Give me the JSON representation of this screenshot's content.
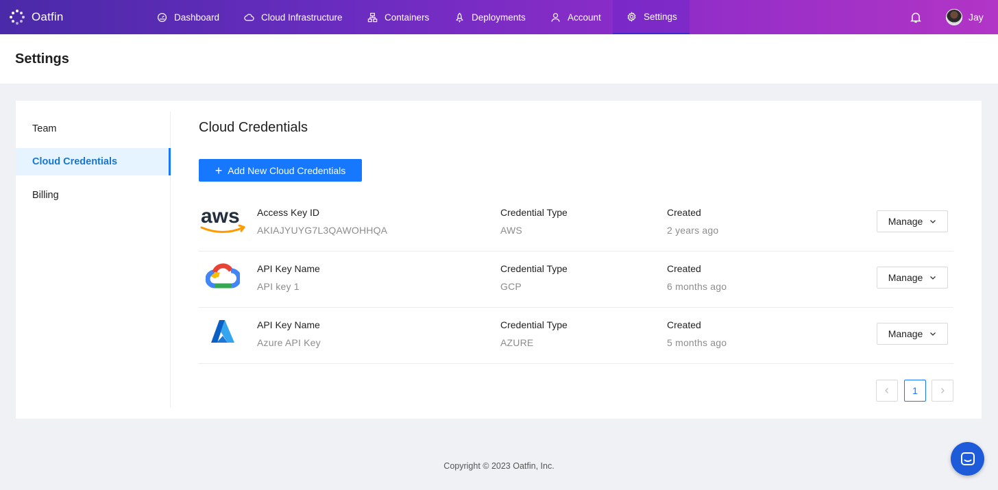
{
  "app": {
    "name": "Oatfin"
  },
  "nav": {
    "items": [
      {
        "label": "Dashboard",
        "icon": "dashboard-icon"
      },
      {
        "label": "Cloud Infrastructure",
        "icon": "cloud-icon"
      },
      {
        "label": "Containers",
        "icon": "cluster-icon"
      },
      {
        "label": "Deployments",
        "icon": "rocket-icon"
      },
      {
        "label": "Account",
        "icon": "user-icon"
      },
      {
        "label": "Settings",
        "icon": "gear-icon",
        "active": true
      }
    ],
    "user": "Jay"
  },
  "page": {
    "title": "Settings"
  },
  "sidebar": {
    "items": [
      {
        "label": "Team"
      },
      {
        "label": "Cloud Credentials",
        "active": true
      },
      {
        "label": "Billing"
      }
    ]
  },
  "main": {
    "title": "Cloud Credentials",
    "add_button": "Add New Cloud Credentials",
    "credentials": [
      {
        "provider": "aws",
        "key_label": "Access Key ID",
        "key_value": "AKIAJYUYG7L3QAWOHHQA",
        "type_label": "Credential Type",
        "type_value": "AWS",
        "created_label": "Created",
        "created_value": "2 years ago",
        "action": "Manage"
      },
      {
        "provider": "gcp",
        "key_label": "API Key Name",
        "key_value": "API key 1",
        "type_label": "Credential Type",
        "type_value": "GCP",
        "created_label": "Created",
        "created_value": "6 months ago",
        "action": "Manage"
      },
      {
        "provider": "azure",
        "key_label": "API Key Name",
        "key_value": "Azure API Key",
        "type_label": "Credential Type",
        "type_value": "AZURE",
        "created_label": "Created",
        "created_value": "5 months ago",
        "action": "Manage"
      }
    ],
    "pagination": {
      "current": "1"
    }
  },
  "footer": {
    "text": "Copyright © 2023 Oatfin, Inc."
  },
  "logos": {
    "aws_text": "aws"
  },
  "colors": {
    "accent": "#1677ff",
    "nav_start": "#4a2aa8",
    "nav_end": "#b235c6"
  }
}
